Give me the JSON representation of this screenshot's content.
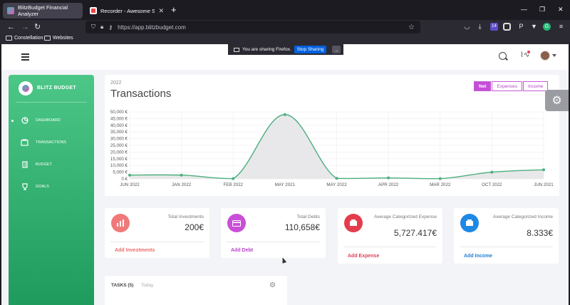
{
  "browser": {
    "tabs": [
      {
        "title": "BlitzBudget Financial Analyzer",
        "active": true
      },
      {
        "title": "Recorder - Awesome Screensh",
        "active": false
      }
    ],
    "new_tab": "+",
    "window_controls": [
      "—",
      "❐",
      "✕"
    ],
    "url": "https://app.blitzbudget.com",
    "bookmarks": [
      "Constellation",
      "Websites"
    ],
    "extension_badge": "14",
    "sharing_bar": {
      "message": "You are sharing Firefox.",
      "stop_label": "Stop Sharing",
      "minimize_label": "_"
    }
  },
  "sidebar": {
    "brand": "BLITZ BUDGET",
    "items": [
      {
        "label": "DASHBOARD",
        "icon": "pie-chart-icon",
        "active": true
      },
      {
        "label": "TRANSACTIONS",
        "icon": "wallet-icon",
        "active": false
      },
      {
        "label": "BUDGET",
        "icon": "ledger-icon",
        "active": false
      },
      {
        "label": "GOALS",
        "icon": "trophy-icon",
        "active": false
      }
    ]
  },
  "transactions": {
    "year": "2022",
    "title": "Transactions",
    "toggle": [
      "Net",
      "Expenses",
      "Income"
    ],
    "toggle_selected": "Net"
  },
  "chart_data": {
    "type": "area",
    "categories": [
      "JUN 2022",
      "JAN 2022",
      "FEB 2022",
      "MAY 2021",
      "MAY 2022",
      "APR 2022",
      "MAR 2022",
      "OCT 2022",
      "JUN 2021"
    ],
    "values": [
      2800,
      2800,
      200,
      48000,
      400,
      700,
      200,
      5000,
      6800
    ],
    "ylim": [
      0,
      50000
    ],
    "yticks": [
      "0 €",
      "5,000 €",
      "10,000 €",
      "15,000 €",
      "20,000 €",
      "25,000 €",
      "30,000 €",
      "35,000 €",
      "40,000 €",
      "45,000 €",
      "50,000 €"
    ],
    "line_color": "#4caf7d",
    "fill_color": "#e8e8ea",
    "grid": true
  },
  "stats": [
    {
      "label": "Total Investments",
      "value": "200€",
      "action": "Add Investments",
      "color": "#f07a7a",
      "action_color": "#ef6b6b",
      "icon": "bar-chart-icon"
    },
    {
      "label": "Total Debts",
      "value": "110,658€",
      "action": "Add Debt",
      "color": "#c94fd6",
      "action_color": "#b844c8",
      "icon": "credit-card-icon"
    },
    {
      "label": "Average Categorized Expense",
      "value": "5,727.417€",
      "action": "Add Expense",
      "color": "#e43c4c",
      "action_color": "#e0405a",
      "icon": "wallet-icon"
    },
    {
      "label": "Average Categorized Income",
      "value": "8.333€",
      "action": "Add Income",
      "color": "#1e88e5",
      "action_color": "#1e7fd8",
      "icon": "wallet-icon"
    }
  ],
  "tasks": {
    "title": "TASKS (5)",
    "tab2": "Today"
  }
}
